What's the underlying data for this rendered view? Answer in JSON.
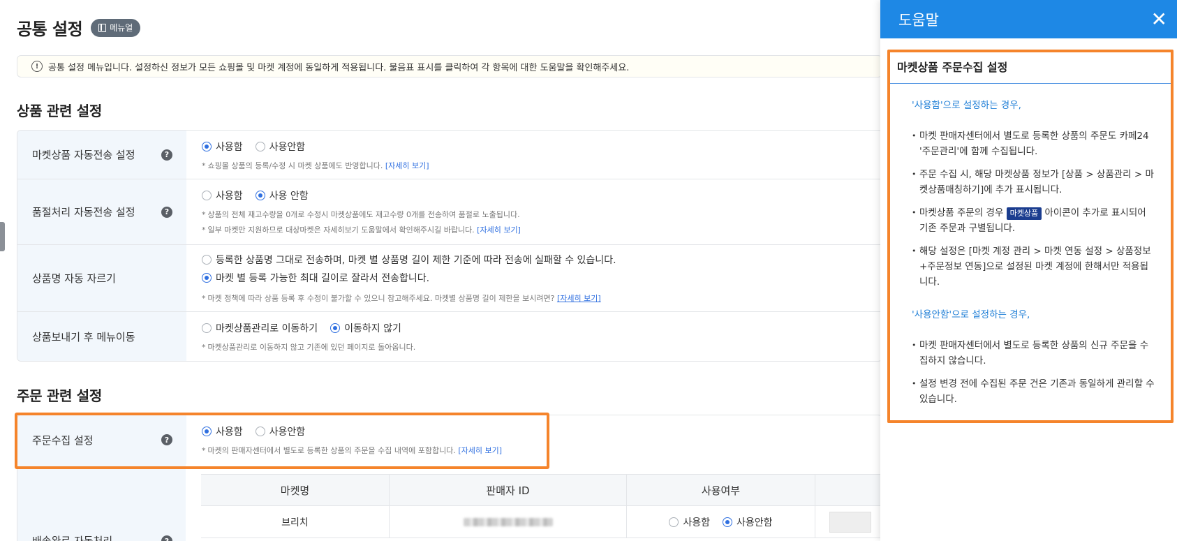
{
  "page": {
    "title": "공통 설정",
    "manual_label": "메뉴얼",
    "notice": "공통 설정 메뉴입니다. 설정하신 정보가 모든 쇼핑몰 및 마켓 계정에 동일하게 적용됩니다. 물음표 표시를 클릭하여 각 항목에 대한 도움말을 확인해주세요."
  },
  "product_section": {
    "title": "상품 관련 설정",
    "rows": [
      {
        "label": "마켓상품 자동전송 설정",
        "options": [
          "사용함",
          "사용안함"
        ],
        "selected": "사용함",
        "hint": "쇼핑몰 상품의 등록/수정 시 마켓 상품에도 반영합니다.",
        "link": "[자세히 보기]"
      },
      {
        "label": "품절처리 자동전송 설정",
        "options": [
          "사용함",
          "사용 안함"
        ],
        "selected": "사용 안함",
        "hint": "상품의 전체 재고수량을 0개로 수정시 마켓상품에도 재고수량 0개를 전송하여 품절로 노출됩니다.",
        "hint2": "일부 마켓만 지원하므로 대상마켓은 자세히보기 도움말에서 확인해주시길 바랍니다.",
        "link": "[자세히 보기]"
      },
      {
        "label": "상품명 자동 자르기",
        "options": [
          "등록한 상품명 그대로 전송하며, 마켓 별 상품명 길이 제한 기준에 따라 전송에 실패할 수 있습니다.",
          "마켓 별 등록 가능한 최대 길이로 잘라서 전송합니다."
        ],
        "selected": "마켓 별 등록 가능한 최대 길이로 잘라서 전송합니다.",
        "hint": "마켓 정책에 따라 상품 등록 후 수정이 불가할 수 있으니 참고해주세요. 마켓별 상품명 길이 제한을 보시려면?",
        "link": "[자세히 보기]"
      },
      {
        "label": "상품보내기 후 메뉴이동",
        "options": [
          "마켓상품관리로 이동하기",
          "이동하지 않기"
        ],
        "selected": "이동하지 않기",
        "hint": "마켓상품관리로 이동하지 않고 기존에 있던 페이지로 돌아옵니다."
      }
    ]
  },
  "order_section": {
    "title": "주문 관련 설정",
    "order_collect": {
      "label": "주문수집 설정",
      "options": [
        "사용함",
        "사용안함"
      ],
      "selected": "사용함",
      "hint": "마켓의 판매자센터에서 별도로 등록한 상품의 주문을 수집 내역에 포함합니다.",
      "link": "[자세히 보기]"
    },
    "delivery_label": "배송완료 자동처리",
    "market_table": {
      "headers": [
        "마켓명",
        "판매자 ID",
        "사용여부"
      ],
      "rows": [
        {
          "market": "브리치",
          "options": [
            "사용함",
            "사용안함"
          ],
          "selected": "사용안함"
        }
      ]
    }
  },
  "help_panel": {
    "title": "도움말",
    "close_glyph": "✕",
    "box_title": "마켓상품 주문수집 설정",
    "case_use": "'사용함'으로 설정하는 경우,",
    "use_items": [
      "마켓 판매자센터에서 별도로 등록한 상품의 주문도 카페24 '주문관리'에 함께 수집됩니다.",
      "주문 수집 시, 해당 마켓상품 정보가 [상품 > 상품관리 > 마켓상품매칭하기]에 추가 표시됩니다."
    ],
    "badge_item_pre": "마켓상품 주문의 경우",
    "badge_label": "마켓상품",
    "badge_item_post": "아이콘이 추가로 표시되어 기존 주문과 구별됩니다.",
    "last_use_item": "해당 설정은 [마켓 계정 관리 > 마켓 연동 설정 > 상품정보+주문정보 연동]으로 설정된 마켓 계정에 한해서만 적용됩니다.",
    "case_not_use": "'사용안함'으로 설정하는 경우,",
    "not_use_items": [
      "마켓 판매자센터에서 별도로 등록한 상품의 신규 주문을 수집하지 않습니다.",
      "설정 변경 전에 수집된 주문 건은 기존과 동일하게 관리할 수 있습니다."
    ]
  },
  "colors": {
    "accent_blue": "#1e88e5",
    "highlight_orange": "#f5842b",
    "label_bg": "#f2f7fc",
    "badge_navy": "#1b3d8f"
  }
}
